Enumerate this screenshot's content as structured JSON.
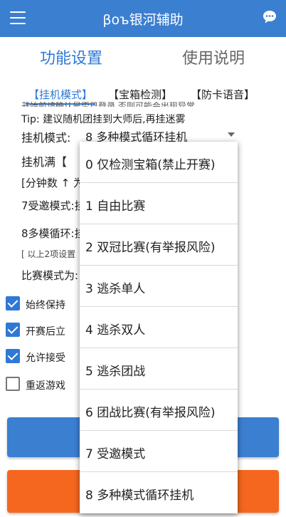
{
  "header": {
    "title": "βoъ银河辅助",
    "menu_icon": "hamburger-menu-icon",
    "chat_icon": "chat-bubble-icon",
    "color": "#3b7fd1"
  },
  "main_tabs": [
    {
      "label": "功能设置",
      "active": true
    },
    {
      "label": "使用说明",
      "active": false
    }
  ],
  "sub_tabs": [
    {
      "label": "【挂机模式】",
      "active": true
    },
    {
      "label": "【宝箱检测】",
      "active": false
    },
    {
      "label": "【防卡语音】",
      "active": false
    }
  ],
  "content": {
    "overlap_text": "开始前请确认是否已登录,否则可能会出现异常",
    "tip": "Tip: 建议随机团挂到大师后,再挂迷雾",
    "mode_label": "挂机模式:",
    "mode_value": "8 多种模式循环挂机",
    "full_label": "挂机满【",
    "min_label": "[分钟数 ↑ 为",
    "invite_label": "7受邀模式:挂",
    "multi_label": "8多模循环:挂",
    "note_label": "[ 以上2项设置",
    "match_label": "比赛模式为:"
  },
  "checkboxes": [
    {
      "label": "始终保持",
      "checked": true
    },
    {
      "label": "开赛后立",
      "checked": true
    },
    {
      "label": "允许接受",
      "checked": true
    },
    {
      "label": "重返游戏",
      "checked": false
    }
  ],
  "buttons": {
    "blue_color": "#3b7fd1",
    "orange_color": "#f5671f"
  },
  "dropdown_options": [
    "0 仅检测宝箱(禁止开赛)",
    "1 自由比赛",
    "2 双冠比赛(有举报风险)",
    "3 逃杀单人",
    "4 逃杀双人",
    "5 逃杀团战",
    "6 团战比赛(有举报风险)",
    "7 受邀模式",
    "8 多种模式循环挂机"
  ]
}
